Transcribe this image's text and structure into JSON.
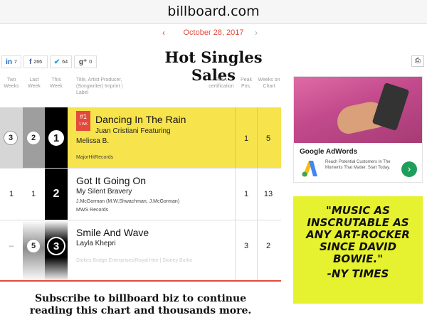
{
  "browser": {
    "url": "billboard.com"
  },
  "date_nav": {
    "prev": "‹",
    "date": "October 28, 2017",
    "next": "›"
  },
  "share": [
    {
      "icon": "linkedin-icon",
      "glyph": "in",
      "count": "7"
    },
    {
      "icon": "facebook-icon",
      "glyph": "f",
      "count": "266"
    },
    {
      "icon": "twitter-icon",
      "glyph": "✔",
      "count": "64"
    },
    {
      "icon": "google-plus-icon",
      "glyph": "g⁺",
      "count": "0"
    }
  ],
  "chart_title": "Hot Singles Sales",
  "columns": {
    "two_weeks": "Two Weeks",
    "last_week": "Last Week",
    "this_week": "This Week",
    "title": "Title, Artist Producer, (Songwriter) Imprint | Label",
    "riaa": "RIAA certification",
    "peak": "Peak Pos.",
    "weeks": "Weeks on Chart"
  },
  "rows": [
    {
      "two_weeks": "3",
      "last_week": "2",
      "this_week": "1",
      "badge": "#1",
      "badge_sub": "1 WK",
      "title": "Dancing In The Rain",
      "artist_line1": "Juan Cristiani Featuring",
      "artist_line2": "Melissa B.",
      "credits": "",
      "label": "MajorHitRecords",
      "peak": "1",
      "weeks": "5"
    },
    {
      "two_weeks": "1",
      "last_week": "1",
      "this_week": "2",
      "title": "Got It Going On",
      "artist_line1": "My Silent Bravery",
      "credits": "J.McGorman (M.W.Shwachman, J.McGorman)",
      "label": "MWS Records",
      "peak": "1",
      "weeks": "13"
    },
    {
      "two_weeks": "–",
      "last_week": "5",
      "this_week": "3",
      "title": "Smile And Wave",
      "artist_line1": "Layla Khepri",
      "label": "Stokes Bridge Enterprises/Royal Heir | Stoney Burke",
      "peak": "3",
      "weeks": "2"
    }
  ],
  "subscribe": "Subscribe to billboard biz to continue reading this chart and thousands more.",
  "ads": {
    "adwords_title": "Google AdWords",
    "adwords_text": "Reach Potential Customers In The Moments That Matter. Start Today.",
    "quote": "\"MUSIC AS INSCRUTABLE AS ANY ART-ROCKER SINCE DAVID BOWIE.\"",
    "cite": "-NY TIMES"
  },
  "colors": {
    "accent": "#e24a3b",
    "highlight": "#f7e34b",
    "ad_yellow": "#e6f12f",
    "go_green": "#1e9e5a"
  }
}
